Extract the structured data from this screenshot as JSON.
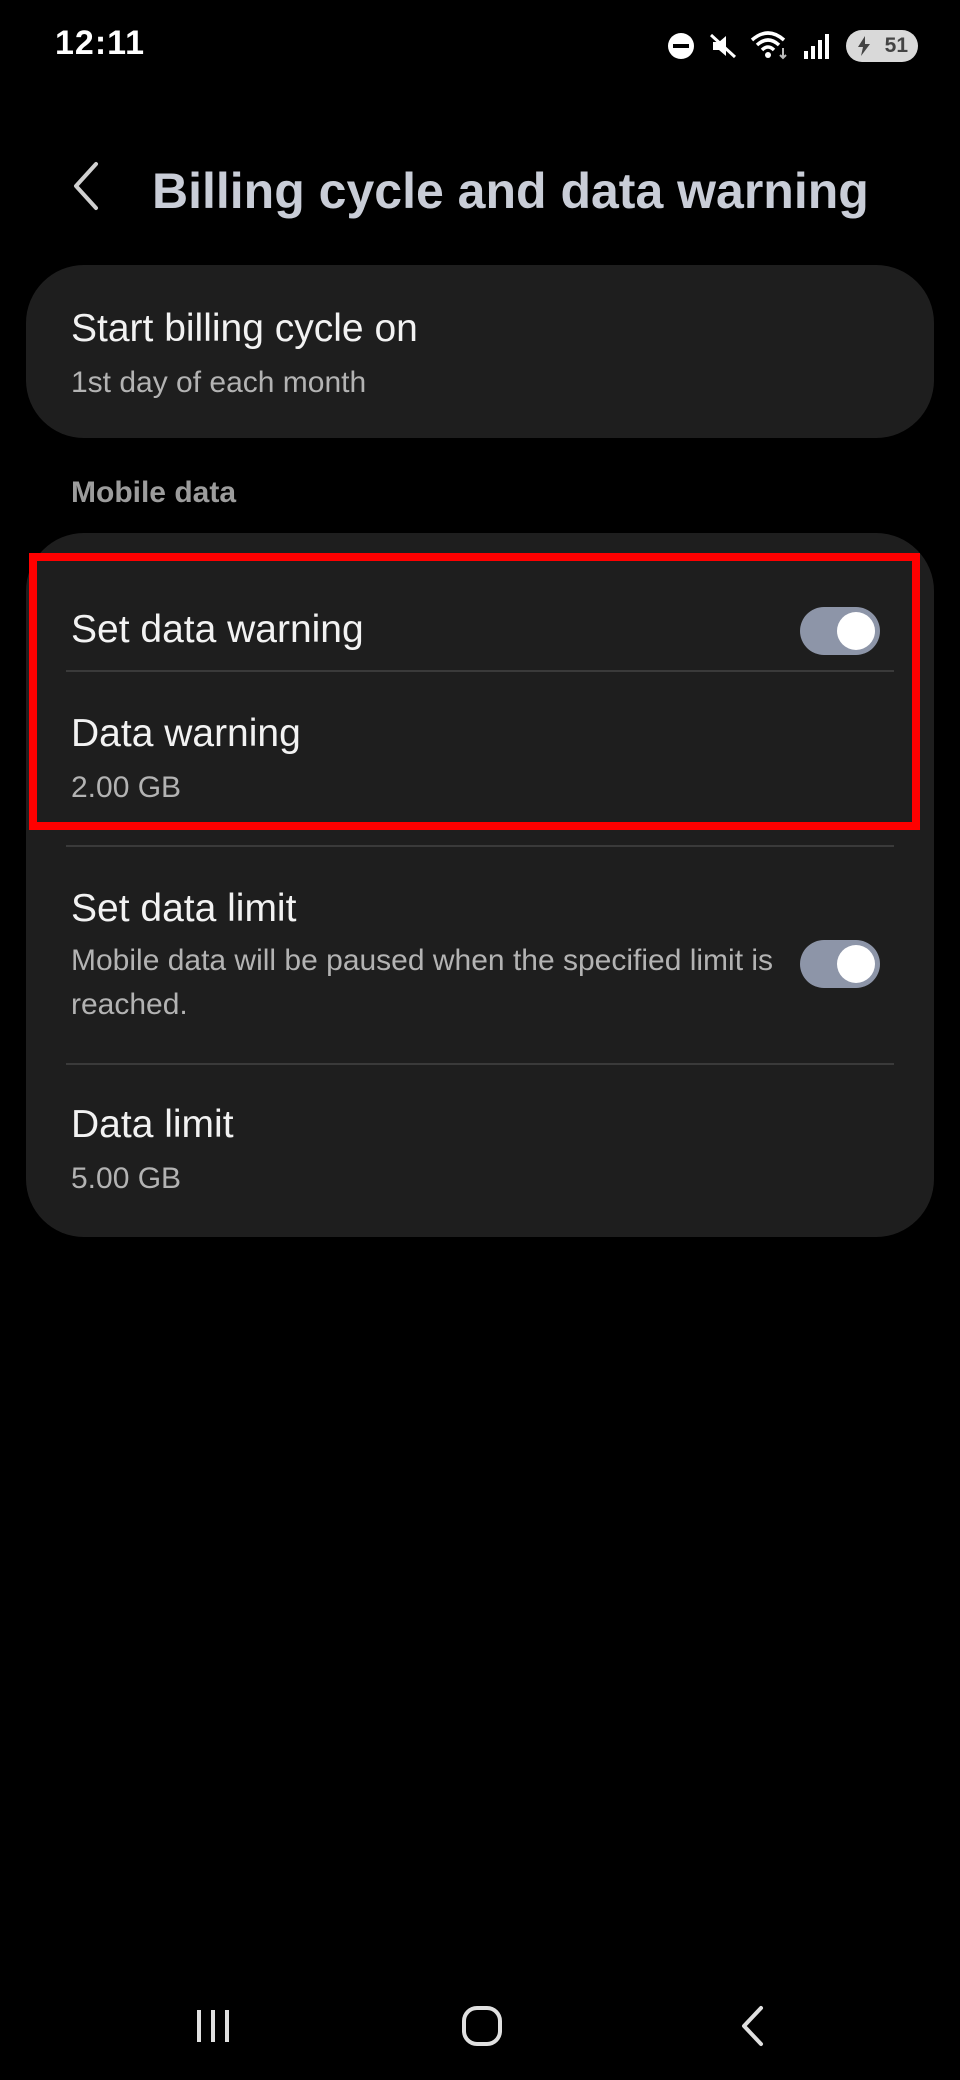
{
  "status_bar": {
    "time": "12:11",
    "battery_level": "51",
    "icons": [
      "do-not-disturb-icon",
      "mute-icon",
      "wifi-icon",
      "signal-icon",
      "battery-icon"
    ]
  },
  "header": {
    "title": "Billing cycle and data warning",
    "back_icon": "chevron-left-icon"
  },
  "billing": {
    "title": "Start billing cycle on",
    "subtitle": "1st day of each month"
  },
  "mobile_data": {
    "section_label": "Mobile data",
    "set_data_warning": {
      "title": "Set data warning",
      "enabled": true
    },
    "data_warning": {
      "title": "Data warning",
      "value": "2.00 GB"
    },
    "set_data_limit": {
      "title": "Set data limit",
      "description": "Mobile data will be paused when the specified limit is reached.",
      "enabled": true
    },
    "data_limit": {
      "title": "Data limit",
      "value": "5.00 GB"
    }
  },
  "highlight": {
    "color": "#ff0000"
  },
  "nav_bar": {
    "icons": [
      "recent-apps-icon",
      "home-icon",
      "back-icon"
    ]
  },
  "colors": {
    "background": "#000000",
    "card": "#1e1e1e",
    "title": "#c9cdd7",
    "toggle_on": "#8d95a8"
  }
}
